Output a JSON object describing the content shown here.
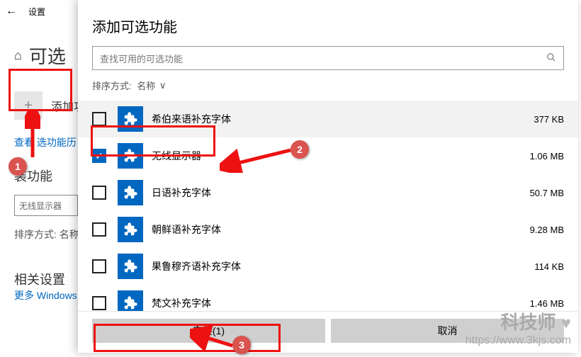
{
  "titlebar": {
    "back": "←",
    "title": "设置"
  },
  "bg": {
    "home_icon": "⌂",
    "page_heading": "可选",
    "add_label": "添加功",
    "history_link": "查看   选功能历",
    "install_heading": "装功能",
    "search_placeholder": "无线显示器",
    "sort_label": "排序方式:",
    "sort_value": "名称",
    "related_heading": "相关设置",
    "more_link": "更多 Windows 功"
  },
  "modal": {
    "title": "添加可选功能",
    "search_placeholder": "查找可用的可选功能",
    "sort_label": "排序方式:",
    "sort_value": "名称",
    "items": [
      {
        "name": "希伯来语补充字体",
        "size": "377 KB",
        "checked": false
      },
      {
        "name": "无线显示器",
        "size": "1.06 MB",
        "checked": true
      },
      {
        "name": "日语补充字体",
        "size": "50.7 MB",
        "checked": false
      },
      {
        "name": "朝鲜语补充字体",
        "size": "9.28 MB",
        "checked": false
      },
      {
        "name": "果鲁穆齐语补充字体",
        "size": "114 KB",
        "checked": false
      },
      {
        "name": "梵文补充字体",
        "size": "1.46 MB",
        "checked": false
      }
    ],
    "install_btn": "安装(1)",
    "cancel_btn": "取消"
  },
  "annotations": {
    "b1": "1",
    "b2": "2",
    "b3": "3"
  },
  "watermark": {
    "brand": "科技师",
    "url": "https://www.3kjs.com"
  }
}
